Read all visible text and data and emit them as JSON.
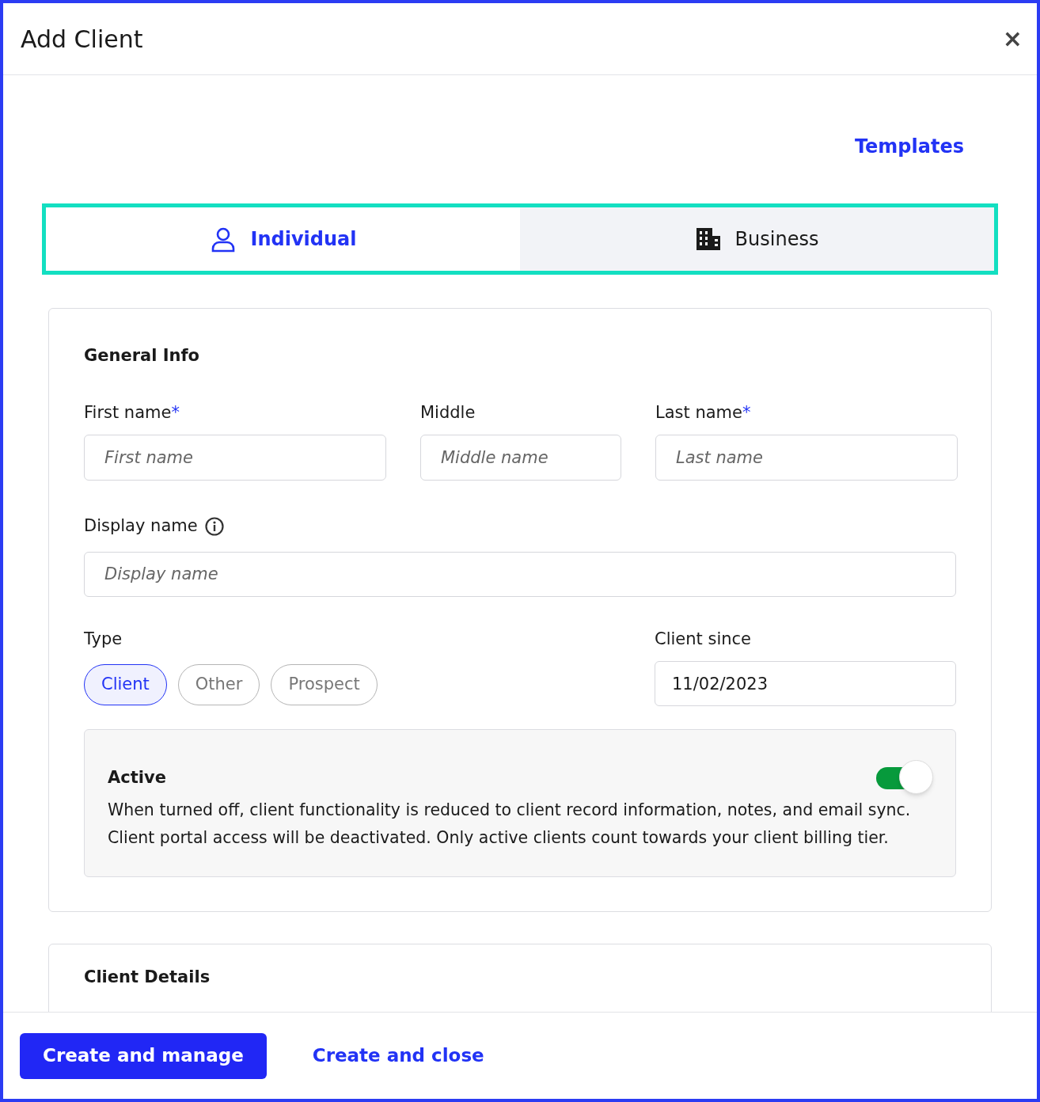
{
  "window": {
    "title": "Add Client",
    "close": "×"
  },
  "templates_link": "Templates",
  "tabs": [
    {
      "label": "Individual",
      "kind": "person",
      "selected": true
    },
    {
      "label": "Business",
      "kind": "building",
      "selected": false
    }
  ],
  "general_info": {
    "heading": "General Info",
    "name_fields": [
      {
        "label": "First name",
        "required_mark": "*",
        "placeholder": "First name"
      },
      {
        "label": "Middle",
        "placeholder": "Middle name"
      },
      {
        "label": "Last name",
        "required_mark": "*",
        "placeholder": "Last name"
      }
    ],
    "display_name": {
      "label": "Display name",
      "placeholder": "Display name"
    },
    "type": {
      "label": "Type",
      "options": [
        {
          "label": "Client",
          "selected": true
        },
        {
          "label": "Other",
          "selected": false
        },
        {
          "label": "Prospect",
          "selected": false
        }
      ]
    },
    "client_since": {
      "label": "Client since",
      "value": "11/02/2023"
    },
    "active": {
      "title": "Active",
      "on": true,
      "description": "When turned off, client functionality is reduced to client record information, notes, and email sync. Client portal access will be deactivated. Only active clients count towards your client billing tier."
    }
  },
  "client_details": {
    "heading": "Client Details"
  },
  "footer": {
    "primary_button": "Create and manage",
    "secondary_button": "Create and close"
  }
}
